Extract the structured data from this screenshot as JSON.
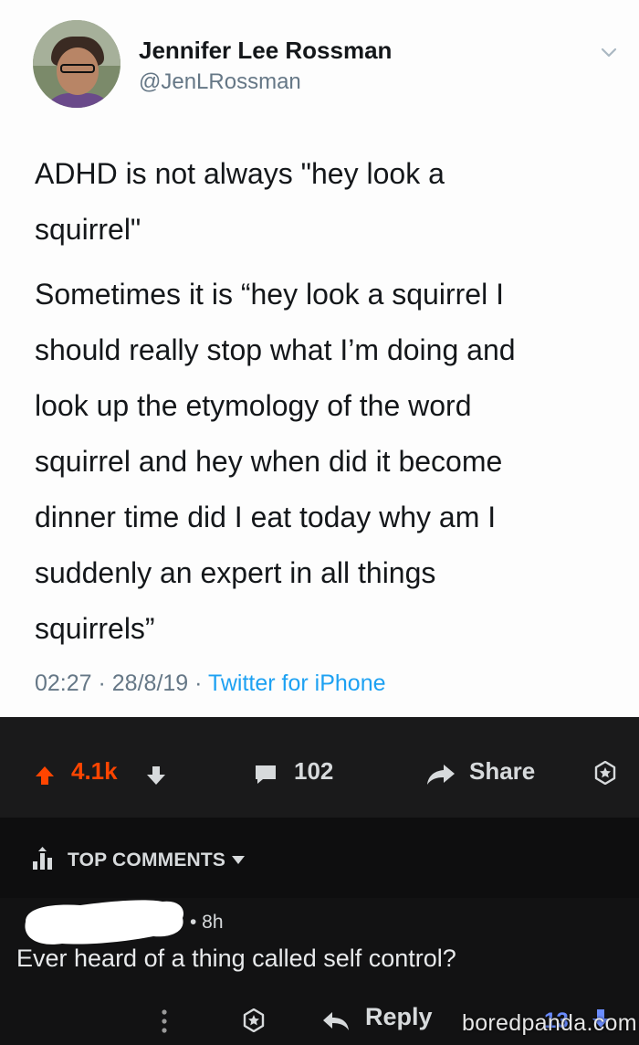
{
  "tweet": {
    "author_name": "Jennifer Lee Rossman",
    "handle": "@JenLRossman",
    "paragraph_1": "ADHD is not always \"hey look a\nsquirrel\"",
    "paragraph_2": "Sometimes it is “hey look a squirrel I\nshould really stop what I’m doing and\nlook up the etymology of the word\nsquirrel and hey when did it become\ndinner time did I eat today why am I\nsuddenly an expert in all things\nsquirrels”",
    "time": "02:27",
    "date": "28/8/19",
    "source": "Twitter for iPhone",
    "separator": " · "
  },
  "post_bar": {
    "vote_count": "4.1k",
    "comment_count": "102",
    "share_label": "Share"
  },
  "comments_header": {
    "sort_label": "TOP COMMENTS"
  },
  "comment": {
    "age": "• 8h",
    "text": "Ever heard of a thing called self control?",
    "reply_label": "Reply",
    "score": "13"
  },
  "watermark": "boredpanda.com",
  "colors": {
    "upvote": "#ff4500",
    "downvote_active": "#6a8cff",
    "twitter_link": "#1da1f2",
    "dark_bar": "#1a1a1b"
  },
  "icons": [
    "upvote-arrow-icon",
    "downvote-arrow-icon",
    "comment-bubble-icon",
    "share-arrow-icon",
    "award-icon",
    "sort-bars-icon",
    "chevron-down-icon",
    "more-dots-icon",
    "reply-arrow-icon"
  ]
}
